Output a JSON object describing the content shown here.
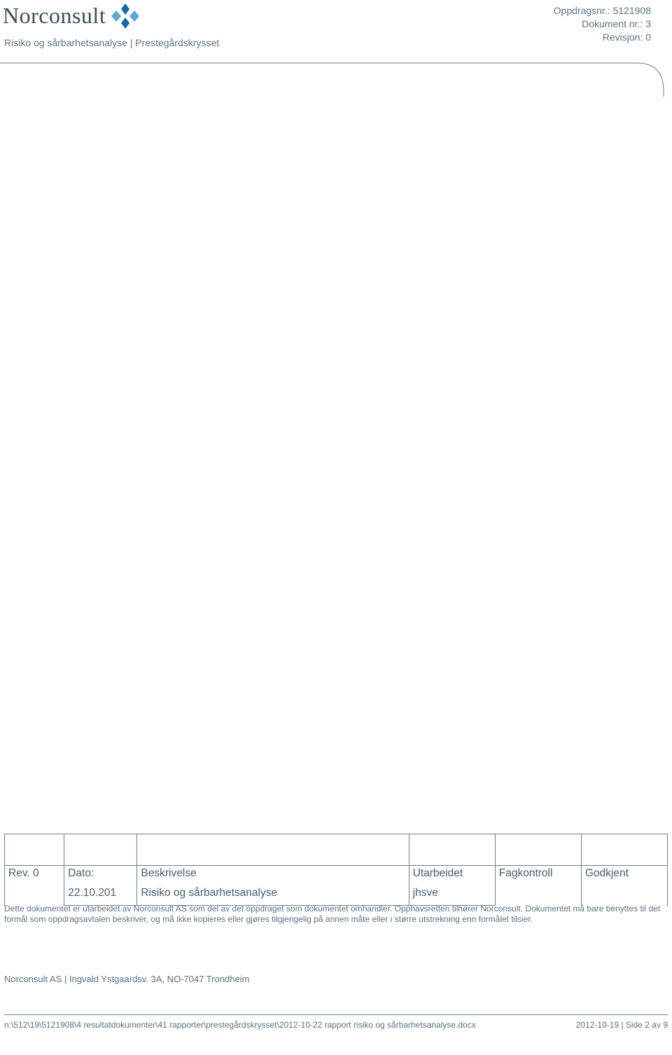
{
  "header": {
    "company_name": "Norconsult",
    "subtitle_left": "Risiko og sårbarhetsanalyse",
    "subtitle_sep": " | ",
    "subtitle_right": "Prestegårdskrysset",
    "right_line1_label": "Oppdragsnr.: ",
    "right_line1_value": "5121908",
    "right_line2_label": "Dokument nr.: ",
    "right_line2_value": "3",
    "right_line3_label": "Revisjon: ",
    "right_line3_value": "0"
  },
  "revision_table": {
    "row1": {
      "c1": "Rev. 0",
      "c2a": "Dato:",
      "c2b": "22.10.201",
      "c3a": "Beskrivelse",
      "c3b": "Risiko og sårbarhetsanalyse",
      "c4a": "Utarbeidet",
      "c4b": "jhsve",
      "c5": "Fagkontroll",
      "c6": "Godkjent"
    }
  },
  "disclaimer": "Dette dokumentet er utarbeidet av Norconsult AS som del av det oppdraget som dokumentet omhandler. Opphavsretten tilhører Norconsult. Dokumentet må bare benyttes til det formål som oppdragsavtalen beskriver, og må ikke kopieres eller gjøres tilgjengelig på annen måte eller i større utstrekning enn formålet tilsier.",
  "address": "Norconsult AS | Ingvald Ystgaardsv. 3A, NO-7047 Trondheim",
  "footer": {
    "path": "n:\\512\\19\\5121908\\4 resultatdokumenter\\41 rapporter\\prestegårdskrysset\\2012-10-22 rapport risiko og sårbarhetsanalyse.docx",
    "date": "2012-10-19",
    "sep": " | ",
    "page_label": "Side ",
    "page_current": "2",
    "page_of": " av ",
    "page_total": "9"
  }
}
